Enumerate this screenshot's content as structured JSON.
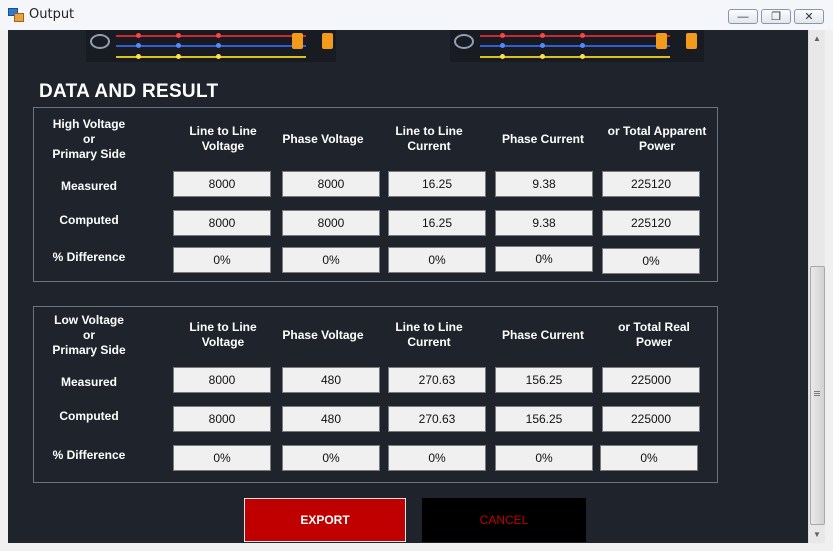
{
  "window": {
    "title": "Output",
    "minimize_icon": "minimize-icon",
    "maximize_icon": "maximize-icon",
    "close_icon": "close-icon"
  },
  "section_title": "DATA AND RESULT",
  "high_side": {
    "side_label_lines": [
      "High Voltage",
      "or",
      "Primary Side"
    ],
    "column_headers": [
      [
        "Line to Line",
        "Voltage"
      ],
      [
        "Phase Voltage"
      ],
      [
        "Line to Line",
        "Current"
      ],
      [
        "Phase Current"
      ],
      [
        "or Total Apparent",
        "Power"
      ]
    ],
    "rows": [
      {
        "label": "Measured",
        "values": [
          "8000",
          "8000",
          "16.25",
          "9.38",
          "225120"
        ]
      },
      {
        "label": "Computed",
        "values": [
          "8000",
          "8000",
          "16.25",
          "9.38",
          "225120"
        ]
      },
      {
        "label": "% Difference",
        "values": [
          "0%",
          "0%",
          "0%",
          "0%",
          "0%"
        ]
      }
    ]
  },
  "low_side": {
    "side_label_lines": [
      "Low Voltage",
      "or",
      "Primary Side"
    ],
    "column_headers": [
      [
        "Line to Line",
        "Voltage"
      ],
      [
        "Phase Voltage"
      ],
      [
        "Line to Line",
        "Current"
      ],
      [
        "Phase Current"
      ],
      [
        "or Total Real",
        "Power"
      ]
    ],
    "rows": [
      {
        "label": "Measured",
        "values": [
          "8000",
          "480",
          "270.63",
          "156.25",
          "225000"
        ]
      },
      {
        "label": "Computed",
        "values": [
          "8000",
          "480",
          "270.63",
          "156.25",
          "225000"
        ]
      },
      {
        "label": "% Difference",
        "values": [
          "0%",
          "0%",
          "0%",
          "0%",
          "0%"
        ]
      }
    ]
  },
  "buttons": {
    "export": "EXPORT",
    "cancel": "CANCEL"
  },
  "colors": {
    "background": "#1f232c",
    "export_button": "#c00000",
    "cancel_button": "#000000",
    "cancel_text": "#c00000"
  }
}
